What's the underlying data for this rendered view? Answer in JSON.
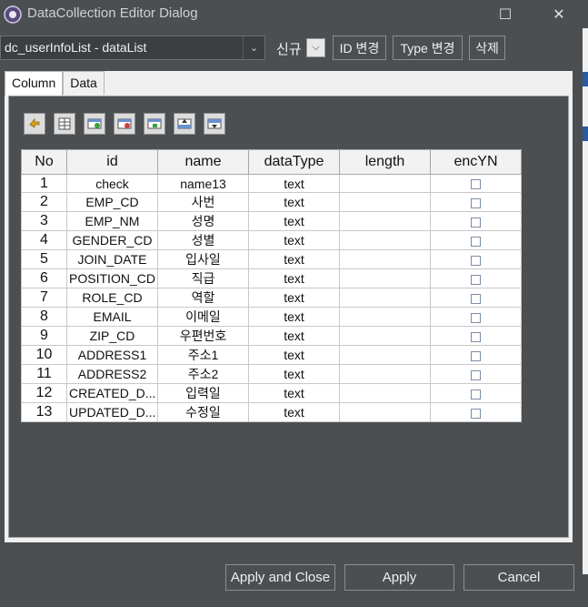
{
  "window": {
    "title": "DataCollection Editor Dialog",
    "maximize_glyph": "☐",
    "close_glyph": "✕"
  },
  "toolbar": {
    "dataset_value": "dc_userInfoList - dataList",
    "new_label": "신규",
    "id_change_label": "ID 변경",
    "type_change_label": "Type 변경",
    "delete_label": "삭제"
  },
  "tabs": [
    {
      "label": "Column"
    },
    {
      "label": "Data"
    }
  ],
  "icon_buttons": [
    "refresh-icon",
    "column-list-icon",
    "add-column-icon",
    "remove-column-icon",
    "insert-column-icon",
    "move-up-icon",
    "move-down-icon"
  ],
  "grid": {
    "headers": [
      "No",
      "id",
      "name",
      "dataType",
      "length",
      "encYN"
    ],
    "rows": [
      {
        "no": "1",
        "id": "check",
        "name": "name13",
        "dataType": "text",
        "length": "",
        "encYN": false
      },
      {
        "no": "2",
        "id": "EMP_CD",
        "name": "사번",
        "dataType": "text",
        "length": "",
        "encYN": false
      },
      {
        "no": "3",
        "id": "EMP_NM",
        "name": "성명",
        "dataType": "text",
        "length": "",
        "encYN": false
      },
      {
        "no": "4",
        "id": "GENDER_CD",
        "name": "성별",
        "dataType": "text",
        "length": "",
        "encYN": false
      },
      {
        "no": "5",
        "id": "JOIN_DATE",
        "name": "입사일",
        "dataType": "text",
        "length": "",
        "encYN": false
      },
      {
        "no": "6",
        "id": "POSITION_CD",
        "name": "직급",
        "dataType": "text",
        "length": "",
        "encYN": false
      },
      {
        "no": "7",
        "id": "ROLE_CD",
        "name": "역할",
        "dataType": "text",
        "length": "",
        "encYN": false
      },
      {
        "no": "8",
        "id": "EMAIL",
        "name": "이메일",
        "dataType": "text",
        "length": "",
        "encYN": false
      },
      {
        "no": "9",
        "id": "ZIP_CD",
        "name": "우편번호",
        "dataType": "text",
        "length": "",
        "encYN": false
      },
      {
        "no": "10",
        "id": "ADDRESS1",
        "name": "주소1",
        "dataType": "text",
        "length": "",
        "encYN": false
      },
      {
        "no": "11",
        "id": "ADDRESS2",
        "name": "주소2",
        "dataType": "text",
        "length": "",
        "encYN": false
      },
      {
        "no": "12",
        "id": "CREATED_D...",
        "name": "입력일",
        "dataType": "text",
        "length": "",
        "encYN": false
      },
      {
        "no": "13",
        "id": "UPDATED_D...",
        "name": "수정일",
        "dataType": "text",
        "length": "",
        "encYN": false
      }
    ]
  },
  "footer": {
    "apply_close_label": "Apply and Close",
    "apply_label": "Apply",
    "cancel_label": "Cancel"
  }
}
